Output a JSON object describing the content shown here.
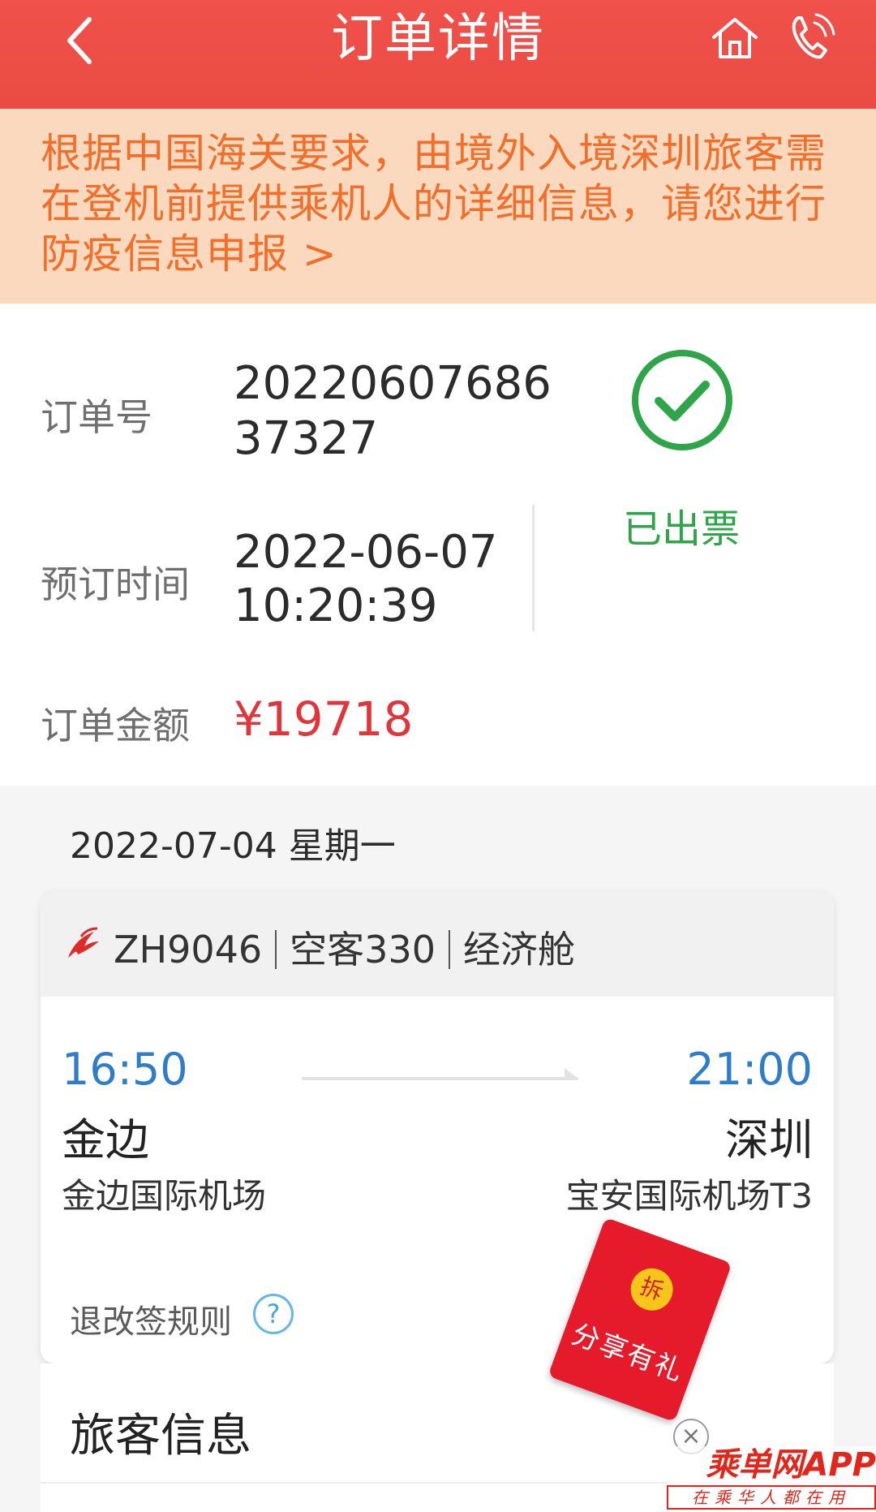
{
  "header": {
    "title": "订单详情",
    "back_icon": "chevron-left-icon",
    "home_icon": "home-icon",
    "phone_icon": "phone-icon",
    "bg_color": "#ea4b43"
  },
  "notice": {
    "text": "根据中国海关要求，由境外入境深圳旅客需在登机前提供乘机人的详细信息，请您进行防疫信息申报 >",
    "color": "#f16e2b",
    "bg_color": "#fbd9be"
  },
  "order": {
    "number_label": "订单号",
    "number_line1": "20220607686",
    "number_line2": "37327",
    "time_label": "预订时间",
    "time_line1": "2022-06-07",
    "time_line2": "10:20:39",
    "amount_label": "订单金额",
    "amount": "¥19718",
    "status": "已出票",
    "status_icon": "check-circle-icon",
    "status_color": "#2fa54a",
    "amount_color": "#e0353a"
  },
  "flight": {
    "date": "2022-07-04 星期一",
    "airline_icon": "shenzhen-airlines-logo-icon",
    "number": "ZH9046",
    "aircraft": "空客330",
    "cabin": "经济舱",
    "depart_time": "16:50",
    "depart_city": "金边",
    "depart_airport": "金边国际机场",
    "arrive_time": "21:00",
    "arrive_city": "深圳",
    "arrive_airport": "宝安国际机场T3",
    "rules_label": "退改签规则",
    "rules_help": "?"
  },
  "promo": {
    "coin_text": "拆",
    "label": "分享有礼",
    "close": "×"
  },
  "passenger": {
    "title": "旅客信息"
  },
  "watermark": {
    "brand": "乘单网APP",
    "slogan": "在乘华人都在用"
  }
}
